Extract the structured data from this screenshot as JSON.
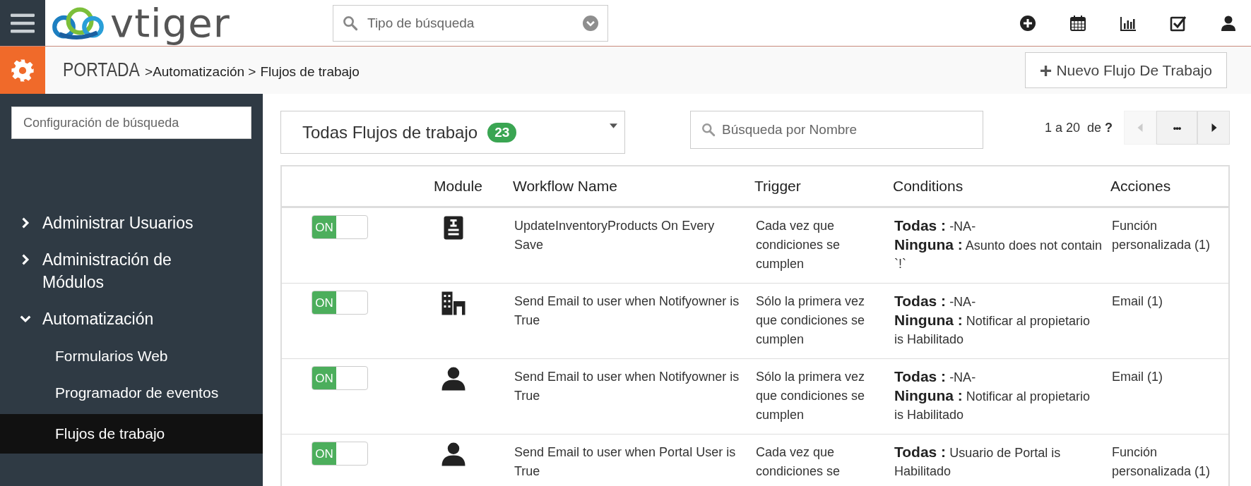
{
  "header": {
    "logo_text": "vtiger",
    "search": {
      "placeholder": "Tipo de búsqueda"
    }
  },
  "breadcrumb": {
    "root": "PORTADA",
    "items": [
      ">Automatización >",
      "Flujos de trabajo"
    ]
  },
  "new_button": {
    "icon": "+",
    "label": "Nuevo Flujo De Trabajo"
  },
  "sidebar": {
    "search": {
      "placeholder": "Configuración de búsqueda"
    },
    "items": [
      {
        "label": "Administrar Usuarios",
        "expanded": false,
        "selected": false
      },
      {
        "label": "Administración de Módulos",
        "expanded": false,
        "selected": false
      },
      {
        "label": "Automatización",
        "expanded": true,
        "selected": false,
        "children": [
          {
            "label": "Formularios Web",
            "selected": false
          },
          {
            "label": "Programador de eventos",
            "selected": false
          },
          {
            "label": "Flujos de trabajo",
            "selected": true
          }
        ]
      }
    ]
  },
  "filter": {
    "label": "Todas Flujos de trabajo",
    "count": "23"
  },
  "name_search": {
    "placeholder": "Búsqueda por Nombre"
  },
  "pager": {
    "range": "1 a 20",
    "of": "de",
    "total": "?",
    "more": "•••"
  },
  "table": {
    "columns": [
      "",
      "Module",
      "Workflow Name",
      "Trigger",
      "Conditions",
      "Acciones"
    ],
    "rows": [
      {
        "on": true,
        "toggle_label": "ON",
        "kind": "document",
        "name": "UpdateInventoryProducts On Every Save",
        "trigger": "Cada vez que condiciones se cumplen",
        "conditions": [
          "**Todas :**  -NA-",
          "**Ninguna :** Asunto does not contain `!`"
        ],
        "action": "Función personalizada (1)"
      },
      {
        "on": true,
        "toggle_label": "ON",
        "kind": "building",
        "name": "Send Email to user when Notifyowner is True",
        "trigger": "Sólo la primera vez que condiciones se cumplen",
        "conditions": [
          "**Todas :**  -NA-",
          "**Ninguna :** Notificar al propietario is Habilitado"
        ],
        "action": "Email (1)"
      },
      {
        "on": true,
        "toggle_label": "ON",
        "kind": "person",
        "name": "Send Email to user when Notifyowner is True",
        "trigger": "Sólo la primera vez que condiciones se cumplen",
        "conditions": [
          "**Todas :**  -NA-",
          "**Ninguna :** Notificar al propietario is Habilitado"
        ],
        "action": "Email (1)"
      },
      {
        "on": true,
        "toggle_label": "ON",
        "kind": "person",
        "name": "Send Email to user when Portal User is True",
        "trigger": "Cada vez que condiciones se",
        "conditions": [
          "**Todas :**  Usuario de Portal is Habilitado"
        ],
        "action": "Función personalizada (1)"
      }
    ]
  }
}
